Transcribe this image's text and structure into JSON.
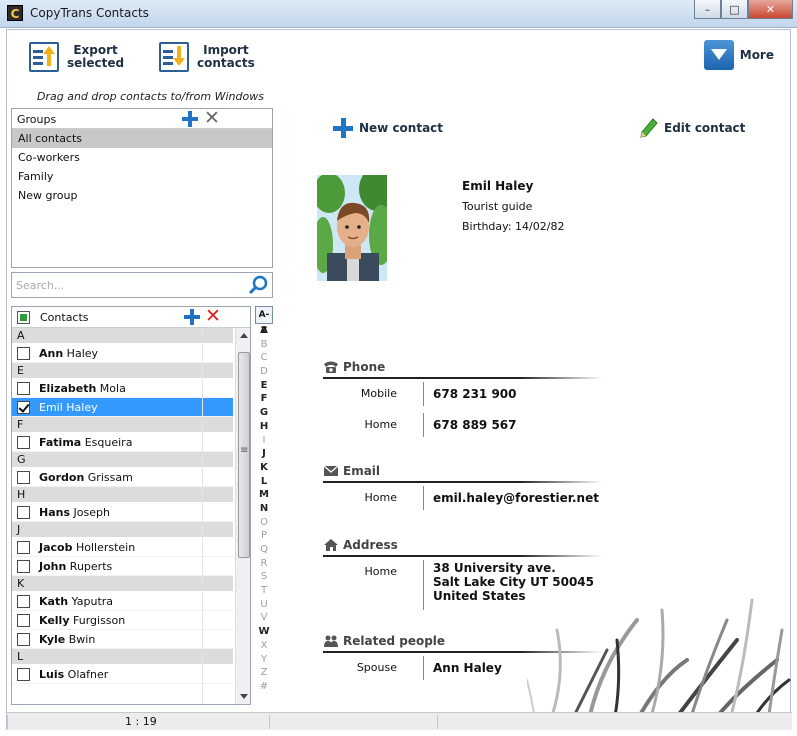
{
  "window": {
    "title": "CopyTrans Contacts",
    "controls": {
      "minimize": "–",
      "maximize": "□",
      "close": "✕"
    }
  },
  "toolbar": {
    "export_label_1": "Export",
    "export_label_2": "selected",
    "import_label_1": "Import",
    "import_label_2": "contacts",
    "more_label": "More"
  },
  "hint": "Drag and drop contacts to/from Windows",
  "groups": {
    "title": "Groups",
    "items": [
      {
        "label": "All contacts",
        "selected": true
      },
      {
        "label": "Co-workers"
      },
      {
        "label": "Family"
      },
      {
        "label": "New group"
      }
    ]
  },
  "search": {
    "placeholder": "Search..."
  },
  "contacts": {
    "title": "Contacts",
    "sections": [
      {
        "letter": "A",
        "rows": [
          {
            "first": "Ann",
            "last": " Haley"
          }
        ]
      },
      {
        "letter": "E",
        "rows": [
          {
            "first": "Elizabeth",
            "last": " Mola"
          },
          {
            "first": "Emil",
            "last": " Haley",
            "selected": true
          }
        ]
      },
      {
        "letter": "F",
        "rows": [
          {
            "first": "Fatima",
            "last": " Esqueira"
          }
        ]
      },
      {
        "letter": "G",
        "rows": [
          {
            "first": "Gordon",
            "last": " Grissam"
          }
        ]
      },
      {
        "letter": "H",
        "rows": [
          {
            "first": "Hans",
            "last": " Joseph"
          }
        ]
      },
      {
        "letter": "J",
        "rows": [
          {
            "first": "Jacob",
            "last": " Hollerstein"
          },
          {
            "first": "John",
            "last": " Ruperts"
          }
        ]
      },
      {
        "letter": "K",
        "rows": [
          {
            "first": "Kath",
            "last": " Yaputra"
          },
          {
            "first": "Kelly",
            "last": " Furgisson"
          },
          {
            "first": "Kyle",
            "last": " Bwin"
          }
        ]
      },
      {
        "letter": "L",
        "rows": [
          {
            "first": "Luis",
            "last": " Olafner"
          }
        ]
      }
    ]
  },
  "alphabet": {
    "az_label": "A-Z",
    "letters": [
      "A",
      "B",
      "C",
      "D",
      "E",
      "F",
      "G",
      "H",
      "I",
      "J",
      "K",
      "L",
      "M",
      "N",
      "O",
      "P",
      "Q",
      "R",
      "S",
      "T",
      "U",
      "V",
      "W",
      "X",
      "Y",
      "Z",
      "#"
    ],
    "dim": [
      "B",
      "C",
      "D",
      "I",
      "O",
      "P",
      "Q",
      "R",
      "S",
      "T",
      "U",
      "V",
      "X",
      "Y",
      "Z",
      "#"
    ]
  },
  "actions": {
    "new_contact": "New contact",
    "edit_contact": "Edit contact"
  },
  "person": {
    "name": "Emil Haley",
    "title": "Tourist guide",
    "birthday": "Birthday: 14/02/82"
  },
  "phone": {
    "title": "Phone",
    "rows": [
      {
        "k": "Mobile",
        "v": "678 231 900"
      },
      {
        "k": "Home",
        "v": "678 889 567"
      }
    ]
  },
  "email": {
    "title": "Email",
    "rows": [
      {
        "k": "Home",
        "v": "emil.haley@forestier.net"
      }
    ]
  },
  "address": {
    "title": "Address",
    "k": "Home",
    "line1": "38 University ave.",
    "line2": "Salt Lake City UT 50045",
    "line3": "United States"
  },
  "related": {
    "title": "Related people",
    "k": "Spouse",
    "v": "Ann Haley"
  },
  "status": {
    "count": "1 : 19"
  },
  "colors": {
    "accent": "#3399ff",
    "brand_blue": "#1f74c6",
    "delete_red": "#e02020"
  }
}
